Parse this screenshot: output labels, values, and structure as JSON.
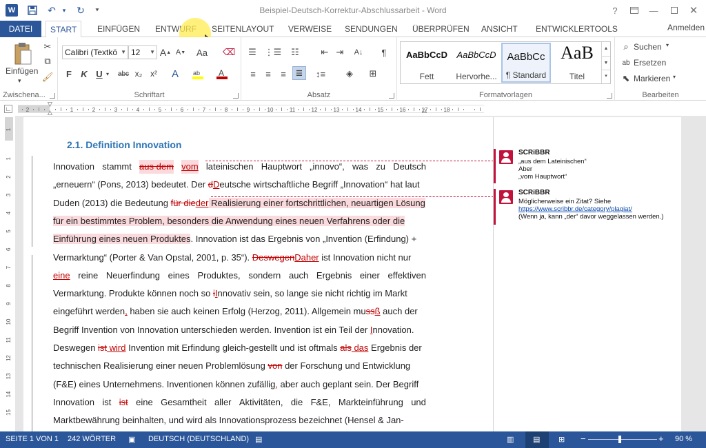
{
  "window": {
    "title": "Beispiel-Deutsch-Korrektur-Abschlussarbeit - Word",
    "help": "?",
    "icons": [
      "word-icon",
      "save-icon",
      "undo-icon",
      "redo-icon",
      "customize-qat-icon",
      "help-icon",
      "ribbon-display-icon",
      "minimize-icon",
      "maximize-icon",
      "close-icon"
    ]
  },
  "tabs": {
    "file": "DATEI",
    "items": [
      "START",
      "EINFÜGEN",
      "ENTWURF",
      "SEITENLAYOUT",
      "VERWEISE",
      "SENDUNGEN",
      "ÜBERPRÜFEN",
      "ANSICHT",
      "ENTWICKLERTOOLS"
    ],
    "active": "START",
    "signin": "Anmelden"
  },
  "ribbon": {
    "clipboard": {
      "paste": "Einfügen",
      "label": "Zwischena..."
    },
    "font": {
      "name": "Calibri (Textkö",
      "size": "12",
      "label": "Schriftart",
      "bold": "F",
      "italic": "K",
      "underline": "U",
      "strike": "abc",
      "sub": "x₂",
      "sup": "x²",
      "grow": "A",
      "shrink": "A",
      "case": "Aa"
    },
    "paragraph": {
      "label": "Absatz",
      "show": "¶"
    },
    "styles": {
      "label": "Formatvorlagen",
      "items": [
        {
          "sample": "AaBbCcD",
          "name": "Fett"
        },
        {
          "sample": "AaBbCcD",
          "name": "Hervorhe..."
        },
        {
          "sample": "AaBbCc",
          "name": "¶ Standard"
        },
        {
          "sample": "AaB",
          "name": "Titel"
        }
      ],
      "selected": "¶ Standard"
    },
    "editing": {
      "find": "Suchen",
      "replace": "Ersetzen",
      "select": "Markieren",
      "label": "Bearbeiten"
    }
  },
  "ruler": {
    "numbers": [
      "1",
      "2",
      "1",
      "2",
      "3",
      "4",
      "5",
      "6",
      "7",
      "8",
      "9",
      "10",
      "11",
      "12",
      "13",
      "14",
      "15",
      "16",
      "17",
      "18"
    ]
  },
  "vruler": {
    "numbers": [
      "1",
      "1",
      "2",
      "3",
      "4",
      "5",
      "6",
      "7",
      "8",
      "9",
      "10",
      "11",
      "12",
      "13",
      "14",
      "15"
    ]
  },
  "document": {
    "heading": "2.1. Definition Innovation",
    "lines": [
      [
        {
          "t": "Innovation"
        },
        {
          "t": "stammt"
        },
        {
          "t": "aus dem",
          "c": "del hl"
        },
        {
          "t": "vom",
          "c": "ins hl"
        },
        {
          "t": "lateinischen"
        },
        {
          "t": "Hauptwort"
        },
        {
          "t": "„innovo“,"
        },
        {
          "t": "was"
        },
        {
          "t": "zu"
        },
        {
          "t": "Deutsch"
        }
      ],
      [
        {
          "t": "„erneuern“ (Pons, 2013) bedeutet. Der "
        },
        {
          "t": "d",
          "c": "del"
        },
        {
          "t": "D",
          "c": "ins"
        },
        {
          "t": "eutsche wirtschaftliche Begriff „Innovation“ hat laut"
        }
      ],
      [
        {
          "t": "Duden (2013) die Bedeutung "
        },
        {
          "t": "für die",
          "c": "del"
        },
        {
          "t": "der",
          "c": "ins"
        },
        {
          "t": " Realisierung einer fortschrittlichen, neuartigen Lösung",
          "c": "hl"
        }
      ],
      [
        {
          "t": "für ein bestimmtes Problem, besonders die Anwendung eines neuen Verfahrens oder die",
          "c": "hl"
        }
      ],
      [
        {
          "t": "Einführung eines neuen Produktes",
          "c": "hl"
        },
        {
          "t": ". Innovation ist das Ergebnis von „Invention (Erfindung) +"
        }
      ],
      [
        {
          "t": "Vermarktung“ (Porter & Van Opstal, 2001, p. 35“). "
        },
        {
          "t": "Deswegen",
          "c": "del"
        },
        {
          "t": "Daher",
          "c": "ins"
        },
        {
          "t": " ist Innovation nicht nur"
        }
      ],
      [
        {
          "t": "eine",
          "c": "ins"
        },
        {
          "t": "reine"
        },
        {
          "t": "Neuerfindung"
        },
        {
          "t": "eines"
        },
        {
          "t": "Produktes,"
        },
        {
          "t": "sondern"
        },
        {
          "t": "auch"
        },
        {
          "t": "Ergebnis"
        },
        {
          "t": "einer"
        },
        {
          "t": "effektiven"
        }
      ],
      [
        {
          "t": "Vermarktung. Produkte können noch so "
        },
        {
          "t": "i",
          "c": "del"
        },
        {
          "t": "I",
          "c": "ins"
        },
        {
          "t": "nnovativ sein, so lange sie nicht richtig im Markt"
        }
      ],
      [
        {
          "t": "eingeführt werden"
        },
        {
          "t": ",",
          "c": "ins"
        },
        {
          "t": " haben sie auch keinen Erfolg (Herzog, 2011). Allgemein mu"
        },
        {
          "t": "ss",
          "c": "del"
        },
        {
          "t": "ß",
          "c": "ins"
        },
        {
          "t": " auch der"
        }
      ],
      [
        {
          "t": "Begriff Invention von Innovation unterschieden werden. Invention ist ein Teil der "
        },
        {
          "t": "I",
          "c": "ins"
        },
        {
          "t": "nnovation."
        }
      ],
      [
        {
          "t": "Deswegen "
        },
        {
          "t": "ist",
          "c": "del"
        },
        {
          "t": " wird",
          "c": "ins"
        },
        {
          "t": " Invention mit Erfindung gleich-gestellt und ist oftmals "
        },
        {
          "t": "als",
          "c": "del"
        },
        {
          "t": " das",
          "c": "ins"
        },
        {
          "t": " Ergebnis der"
        }
      ],
      [
        {
          "t": "technischen Realisierung einer neuen Problemlösung "
        },
        {
          "t": "von",
          "c": "del"
        },
        {
          "t": " der Forschung und Entwicklung"
        }
      ],
      [
        {
          "t": "(F&E) eines Unternehmens. Inventionen können zufällig"
        },
        {
          "t": ",",
          "c": "ins"
        },
        {
          "t": " aber auch geplant sein. Der Begriff"
        }
      ],
      [
        {
          "t": "Innovation"
        },
        {
          "t": "ist"
        },
        {
          "t": "ist",
          "c": "del"
        },
        {
          "t": "eine"
        },
        {
          "t": "Gesamtheit"
        },
        {
          "t": "aller"
        },
        {
          "t": "Aktivitäten,"
        },
        {
          "t": "die"
        },
        {
          "t": "F&E,"
        },
        {
          "t": "Markteinführung"
        },
        {
          "t": "und"
        }
      ],
      [
        {
          "t": "Marktbewährung beinhalten, und wird als Innovationsprozess bezeichnet (Hensel & Jan-"
        }
      ]
    ]
  },
  "comments": [
    {
      "author": "SCRiBBR",
      "lines": [
        "„aus dem Lateinischen“",
        "Aber",
        "„vom Hauptwort“"
      ]
    },
    {
      "author": "SCRiBBR",
      "lines": [
        "Möglicherweise ein Zitat? Siehe",
        "https://www.scribbr.de/category/plagiat/",
        "(Wenn ja, kann „der“ davor weggelassen werden.)"
      ]
    }
  ],
  "status": {
    "page": "SEITE 1 VON 1",
    "words": "242 WÖRTER",
    "language": "DEUTSCH (DEUTSCHLAND)",
    "zoom": "90 %",
    "zoom_minus": "−",
    "zoom_plus": "+"
  }
}
